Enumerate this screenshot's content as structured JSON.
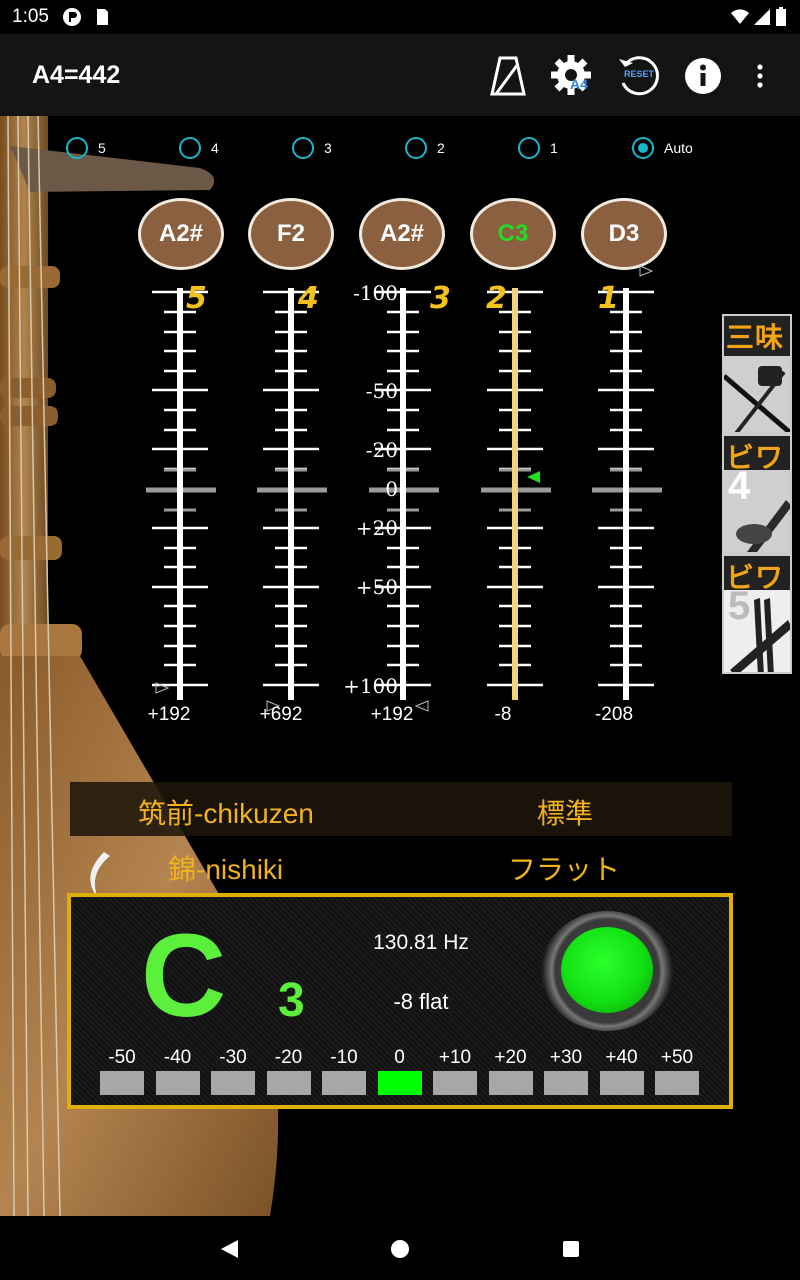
{
  "status_bar": {
    "time": "1:05"
  },
  "toolbar": {
    "title": "A4=442",
    "icons": [
      "metronome-icon",
      "settings-a4-icon",
      "reset-icon",
      "info-icon",
      "more-vert-icon"
    ],
    "settings_badge": "A4",
    "reset_badge": "RESET"
  },
  "string_select": {
    "options": [
      "5",
      "4",
      "3",
      "2",
      "1",
      "Auto"
    ],
    "selected": "Auto"
  },
  "strings": [
    {
      "number": "5",
      "note": "A2#",
      "deviation": "+192",
      "active": false
    },
    {
      "number": "4",
      "note": "F2",
      "deviation": "+692",
      "active": false
    },
    {
      "number": "3",
      "note": "A2#",
      "deviation": "+192",
      "active": false
    },
    {
      "number": "2",
      "note": "C3",
      "deviation": "-8",
      "active": true
    },
    {
      "number": "1",
      "note": "D3",
      "deviation": "-208",
      "active": false
    }
  ],
  "cent_scale": [
    "-100",
    "-50",
    "-20",
    "0",
    "+20",
    "+50",
    "+100"
  ],
  "instruments": [
    {
      "label": "三味",
      "number": ""
    },
    {
      "label": "ビワ",
      "number": "4"
    },
    {
      "label": "ビワ",
      "number": "5"
    }
  ],
  "tuning": {
    "style": "筑前-chikuzen",
    "pitch": "標準",
    "variant": "錦-nishiki",
    "mode": "フラット"
  },
  "tuner": {
    "note": "C",
    "octave": "3",
    "frequency": "130.81 Hz",
    "cents_text": "-8 flat",
    "in_tune": true,
    "meter_labels": [
      "-50",
      "-40",
      "-30",
      "-20",
      "-10",
      "0",
      "+10",
      "+20",
      "+30",
      "+40",
      "+50"
    ],
    "meter_active": "0"
  },
  "colors": {
    "accent": "#19b6c9",
    "note_green": "#5cf03c",
    "label_gold": "#f2b21c",
    "panel_border": "#e0b000"
  }
}
